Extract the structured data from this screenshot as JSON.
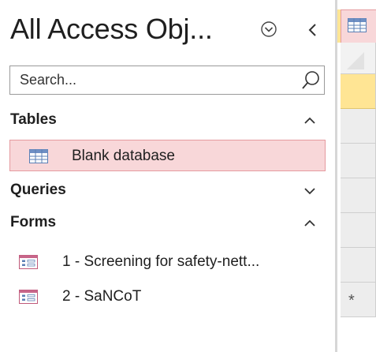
{
  "nav_pane": {
    "title": "All Access Obj...",
    "menu_icon": "circle-chevron-down-icon",
    "collapse_icon": "chevron-left-icon",
    "search": {
      "placeholder": "Search...",
      "value": "",
      "icon": "search-icon"
    },
    "groups": [
      {
        "label": "Tables",
        "expanded": true,
        "chevron": "chevron-up-icon",
        "items": [
          {
            "label": "Blank database",
            "icon": "table-icon",
            "selected": true
          }
        ]
      },
      {
        "label": "Queries",
        "expanded": false,
        "chevron": "chevron-down-icon",
        "items": []
      },
      {
        "label": "Forms",
        "expanded": true,
        "chevron": "chevron-up-icon",
        "items": [
          {
            "label": "1 - Screening for safety-nett...",
            "icon": "form-icon",
            "selected": false
          },
          {
            "label": "2 - SaNCoT",
            "icon": "form-icon",
            "selected": false
          }
        ]
      }
    ]
  },
  "datasheet": {
    "tab_icon": "table-icon",
    "new_record_marker": "*"
  },
  "colors": {
    "selection_fill": "#f8d7d9",
    "selection_border": "#e59a9f",
    "current_row": "#ffe594",
    "text": "#1f1f1f"
  }
}
